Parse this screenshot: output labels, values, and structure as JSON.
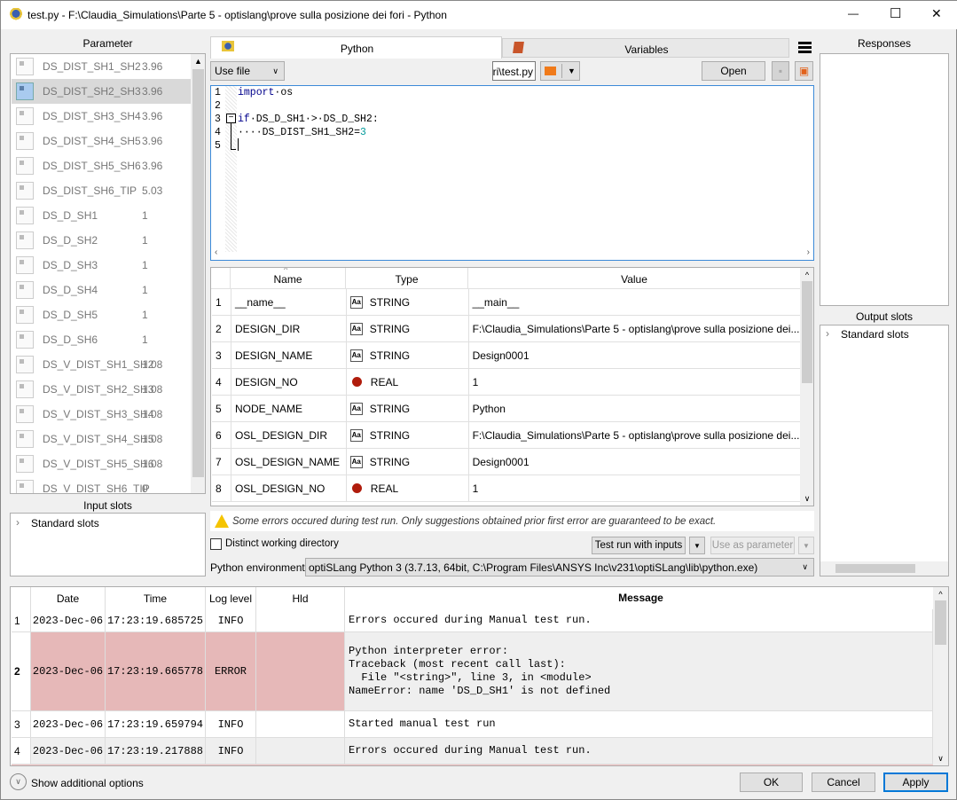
{
  "window": {
    "title": "test.py - F:\\Claudia_Simulations\\Parte 5 - optislang\\prove sulla posizione dei fori - Python",
    "minimize": "—",
    "maximize": "☐",
    "close": "✕"
  },
  "left": {
    "parameter_label": "Parameter",
    "parameters": [
      {
        "name": "DS_DIST_SH1_SH2",
        "value": "3.96"
      },
      {
        "name": "DS_DIST_SH2_SH3",
        "value": "3.96"
      },
      {
        "name": "DS_DIST_SH3_SH4",
        "value": "3.96"
      },
      {
        "name": "DS_DIST_SH4_SH5",
        "value": "3.96"
      },
      {
        "name": "DS_DIST_SH5_SH6",
        "value": "3.96"
      },
      {
        "name": "DS_DIST_SH6_TIP",
        "value": "5.03"
      },
      {
        "name": "DS_D_SH1",
        "value": "1"
      },
      {
        "name": "DS_D_SH2",
        "value": "1"
      },
      {
        "name": "DS_D_SH3",
        "value": "1"
      },
      {
        "name": "DS_D_SH4",
        "value": "1"
      },
      {
        "name": "DS_D_SH5",
        "value": "1"
      },
      {
        "name": "DS_D_SH6",
        "value": "1"
      },
      {
        "name": "DS_V_DIST_SH1_SH2",
        "value": "1.08"
      },
      {
        "name": "DS_V_DIST_SH2_SH3",
        "value": "1.08"
      },
      {
        "name": "DS_V_DIST_SH3_SH4",
        "value": "1.08"
      },
      {
        "name": "DS_V_DIST_SH4_SH5",
        "value": "1.08"
      },
      {
        "name": "DS_V_DIST_SH5_SH6",
        "value": "1.08"
      },
      {
        "name": "DS_V_DIST_SH6_TIP",
        "value": "0"
      }
    ],
    "input_slots_label": "Input slots",
    "input_slots_item": "Standard slots"
  },
  "tabs": {
    "python": "Python",
    "variables": "Variables"
  },
  "toolbar": {
    "mode": "Use file",
    "file": "ri\\test.py",
    "open": "Open"
  },
  "editor": {
    "line_numbers": [
      "1",
      "2",
      "3",
      "4",
      "5"
    ],
    "lines": [
      [
        {
          "t": "import",
          "c": "#00008b"
        },
        {
          "t": "·os",
          "c": "#000"
        }
      ],
      [],
      [
        {
          "t": "if",
          "c": "#00008b"
        },
        {
          "t": "·DS_D_SH1·>·DS_D_SH2:",
          "c": "#000"
        }
      ],
      [
        {
          "t": "····DS_DIST_SH1_SH2=",
          "c": "#000"
        },
        {
          "t": "3",
          "c": "#009999"
        }
      ],
      []
    ]
  },
  "variables": {
    "headers": [
      "Name",
      "Type",
      "Value"
    ],
    "rows": [
      {
        "n": "1",
        "name": "__name__",
        "type": "STRING",
        "value": "__main__"
      },
      {
        "n": "2",
        "name": "DESIGN_DIR",
        "type": "STRING",
        "value": "F:\\Claudia_Simulations\\Parte 5 - optislang\\prove sulla posizione dei..."
      },
      {
        "n": "3",
        "name": "DESIGN_NAME",
        "type": "STRING",
        "value": "Design0001"
      },
      {
        "n": "4",
        "name": "DESIGN_NO",
        "type": "REAL",
        "value": "1"
      },
      {
        "n": "5",
        "name": "NODE_NAME",
        "type": "STRING",
        "value": "Python"
      },
      {
        "n": "6",
        "name": "OSL_DESIGN_DIR",
        "type": "STRING",
        "value": "F:\\Claudia_Simulations\\Parte 5 - optislang\\prove sulla posizione dei..."
      },
      {
        "n": "7",
        "name": "OSL_DESIGN_NAME",
        "type": "STRING",
        "value": "Design0001"
      },
      {
        "n": "8",
        "name": "OSL_DESIGN_NO",
        "type": "REAL",
        "value": "1"
      }
    ]
  },
  "warning": "Some errors occured during test run. Only suggestions obtained prior first error are guaranteed to be exact.",
  "options": {
    "distinct_dir": "Distinct working directory",
    "test_run": "Test run with inputs",
    "use_as_param": "Use as parameter",
    "env_label": "Python environment:",
    "env_value": "optiSLang Python 3 (3.7.13, 64bit, C:\\Program Files\\ANSYS Inc\\v231\\optiSLang\\lib\\python.exe)"
  },
  "right": {
    "responses_label": "Responses",
    "output_slots_label": "Output slots",
    "output_slots_item": "Standard slots"
  },
  "log": {
    "headers": [
      "Date",
      "Time",
      "Log level",
      "Hld",
      "Message"
    ],
    "rows": [
      {
        "n": "1",
        "date": "2023-Dec-06",
        "time": "17:23:19.685725",
        "level": "INFO",
        "hld": "",
        "msg": "Errors occured during Manual test run."
      },
      {
        "n": "2",
        "date": "2023-Dec-06",
        "time": "17:23:19.665778",
        "level": "ERROR",
        "hld": "",
        "msg": "Python interpreter error:\nTraceback (most recent call last):\n  File \"<string>\", line 3, in <module>\nNameError: name 'DS_D_SH1' is not defined"
      },
      {
        "n": "3",
        "date": "2023-Dec-06",
        "time": "17:23:19.659794",
        "level": "INFO",
        "hld": "",
        "msg": "Started manual test run"
      },
      {
        "n": "4",
        "date": "2023-Dec-06",
        "time": "17:23:19.217888",
        "level": "INFO",
        "hld": "",
        "msg": "Errors occured during Manual test run."
      }
    ]
  },
  "footer": {
    "show_options": "Show additional options",
    "ok": "OK",
    "cancel": "Cancel",
    "apply": "Apply"
  }
}
